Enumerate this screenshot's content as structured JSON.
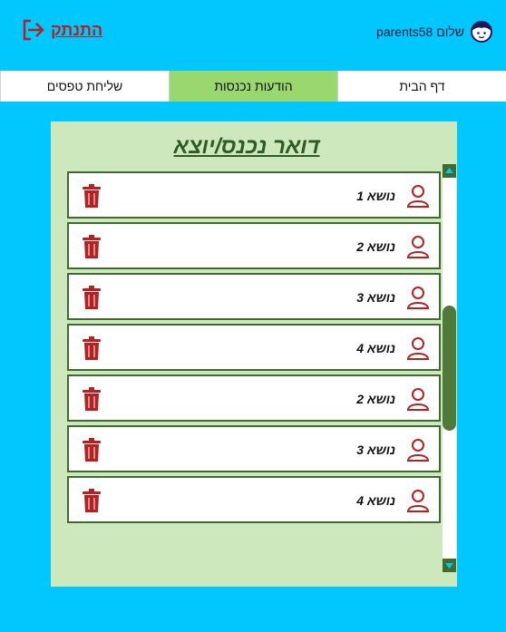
{
  "header": {
    "logout_label": "התנתק",
    "greeting": "שלום parents58",
    "icons": {
      "logout": "logout-icon",
      "avatar": "user-avatar-icon"
    }
  },
  "tabs": [
    {
      "label": "דף הבית",
      "active": false
    },
    {
      "label": "הודעות נכנסות",
      "active": true
    },
    {
      "label": "שליחת טפסים",
      "active": false
    }
  ],
  "mailbox": {
    "title": "דואר נכנס/יוצא",
    "messages": [
      {
        "subject": "נושא 1"
      },
      {
        "subject": "נושא 2"
      },
      {
        "subject": "נושא 3"
      },
      {
        "subject": "נושא 4"
      },
      {
        "subject": "נושא 2"
      },
      {
        "subject": "נושא 3"
      },
      {
        "subject": "נושא 4"
      }
    ],
    "row_icons": {
      "sender": "user-icon",
      "delete": "trash-icon"
    }
  },
  "colors": {
    "page_background": "#00c8ff",
    "panel_background": "#cde8bc",
    "active_tab": "#98d86e",
    "row_border": "#3f6b30",
    "accent_red": "#b22222",
    "title_green": "#2e5a25"
  }
}
